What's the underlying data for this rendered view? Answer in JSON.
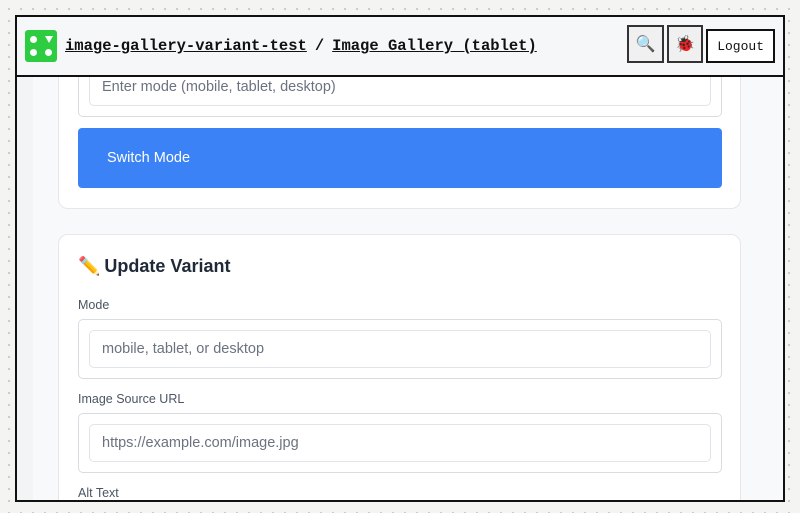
{
  "header": {
    "project": "image-gallery-variant-test",
    "separator": "/",
    "page": "Image Gallery (tablet)",
    "search_icon": "🔍",
    "bug_icon": "🐞",
    "logout_label": "Logout"
  },
  "mode_card": {
    "mode_placeholder": "Enter mode (mobile, tablet, desktop)",
    "switch_label": "Switch Mode"
  },
  "update_card": {
    "title_icon": "✏️",
    "title": "Update Variant",
    "mode_label": "Mode",
    "mode_placeholder": "mobile, tablet, or desktop",
    "src_label": "Image Source URL",
    "src_placeholder": "https://example.com/image.jpg",
    "alt_label": "Alt Text"
  },
  "colors": {
    "accent": "#3b82f6",
    "logo": "#2ecc40"
  }
}
